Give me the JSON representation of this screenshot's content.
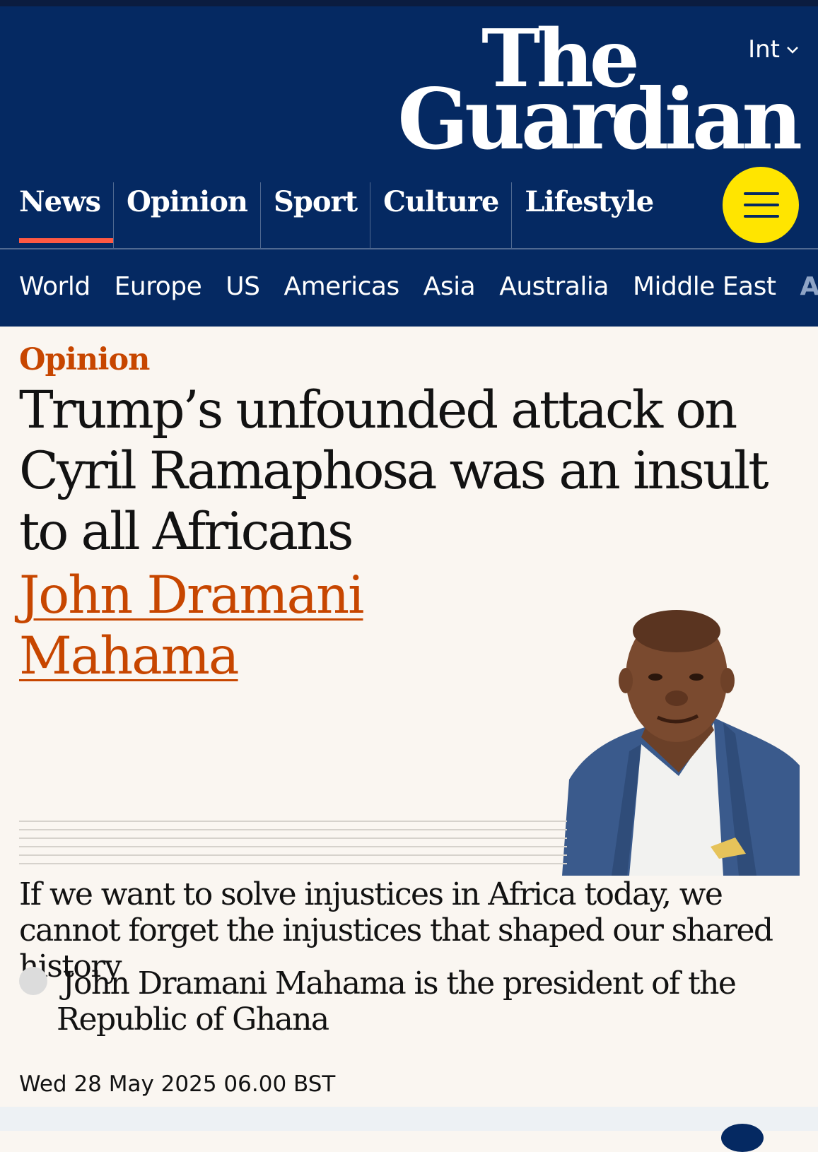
{
  "masthead": {
    "logo_line1": "The",
    "logo_line2": "Guardian",
    "edition": "Int",
    "pillars": [
      "News",
      "Opinion",
      "Sport",
      "Culture",
      "Lifestyle"
    ],
    "active_pillar": "News",
    "subnav": [
      "World",
      "Europe",
      "US",
      "Americas",
      "Asia",
      "Australia",
      "Middle East",
      "Afri"
    ]
  },
  "article": {
    "kicker": "Opinion",
    "headline": "Trump’s unfounded attack on Cyril Ramaphosa was an insult to all Africans",
    "byline_line1": "John Dramani",
    "byline_line2": "Mahama",
    "standfirst": "If we want to solve injustices in Africa today, we cannot forget the injustices that shaped our shared history",
    "contributor_line1": "John Dramani Mahama is the president of the",
    "contributor_line2": "Republic of Ghana",
    "date": "Wed 28 May 2025 06.00 BST"
  },
  "colors": {
    "brand_blue": "#052962",
    "opinion_orange": "#c74600",
    "menu_yellow": "#ffe500",
    "active_underline": "#ff5943",
    "background": "#faf6f1"
  }
}
